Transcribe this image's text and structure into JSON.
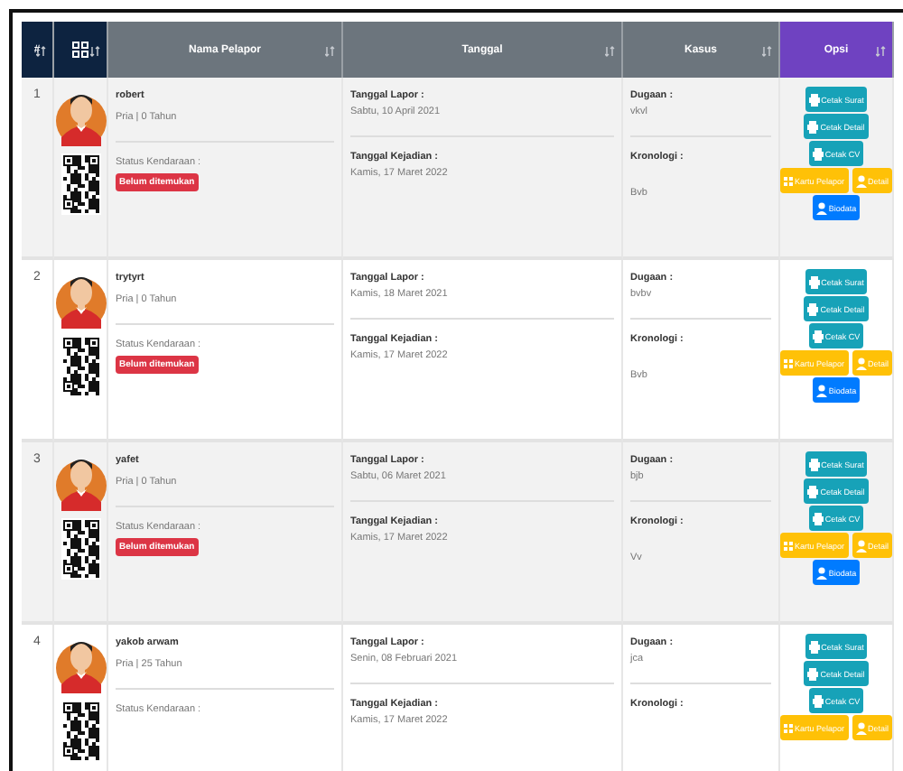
{
  "table": {
    "columns": [
      {
        "kind": "index",
        "label": "#"
      },
      {
        "kind": "qr"
      },
      {
        "kind": "plain",
        "label": "Nama Pelapor"
      },
      {
        "kind": "plain",
        "label": "Tanggal"
      },
      {
        "kind": "plain",
        "label": "Kasus"
      },
      {
        "kind": "action",
        "label": "Opsi"
      }
    ],
    "rows": [
      {
        "number": "1",
        "name": "robert",
        "gender_age": "Pria | 0 Tahun",
        "status_label": "Status Kendaraan :",
        "status": "Belum ditemukan",
        "report_label": "Tanggal Lapor :",
        "report_date": "Sabtu, 10 April 2021",
        "incident_label": "Tanggal Kejadian :",
        "incident_date": "Kamis, 17 Maret 2022",
        "suspect_label": "Dugaan :",
        "suspect": "vkvl",
        "chronology_label": "Kronologi :",
        "chronology": "Bvb",
        "actions": [
          {
            "kind": "print",
            "label": "Cetak Surat"
          },
          {
            "kind": "print",
            "label": "Cetak Detail"
          },
          {
            "kind": "print",
            "label": "Cetak CV"
          },
          {
            "kind": "card",
            "label": "Kartu Pelapor"
          },
          {
            "kind": "detail",
            "label": "Detail"
          },
          {
            "kind": "bio",
            "label": "Biodata"
          }
        ]
      },
      {
        "number": "2",
        "name": "trytyrt",
        "gender_age": "Pria | 0 Tahun",
        "status_label": "Status Kendaraan :",
        "status": "Belum ditemukan",
        "report_label": "Tanggal Lapor :",
        "report_date": "Kamis, 18 Maret 2021",
        "incident_label": "Tanggal Kejadian :",
        "incident_date": "Kamis, 17 Maret 2022",
        "suspect_label": "Dugaan :",
        "suspect": "bvbv",
        "chronology_label": "Kronologi :",
        "chronology": "Bvb",
        "actions": [
          {
            "kind": "print",
            "label": "Cetak Surat"
          },
          {
            "kind": "print",
            "label": "Cetak Detail"
          },
          {
            "kind": "print",
            "label": "Cetak CV"
          },
          {
            "kind": "card",
            "label": "Kartu Pelapor"
          },
          {
            "kind": "detail",
            "label": "Detail"
          },
          {
            "kind": "bio",
            "label": "Biodata"
          }
        ]
      },
      {
        "number": "3",
        "name": "yafet",
        "gender_age": "Pria | 0 Tahun",
        "status_label": "Status Kendaraan :",
        "status": "Belum ditemukan",
        "report_label": "Tanggal Lapor :",
        "report_date": "Sabtu, 06 Maret 2021",
        "incident_label": "Tanggal Kejadian :",
        "incident_date": "Kamis, 17 Maret 2022",
        "suspect_label": "Dugaan :",
        "suspect": "bjb",
        "chronology_label": "Kronologi :",
        "chronology": "Vv",
        "actions": [
          {
            "kind": "print",
            "label": "Cetak Surat"
          },
          {
            "kind": "print",
            "label": "Cetak Detail"
          },
          {
            "kind": "print",
            "label": "Cetak CV"
          },
          {
            "kind": "card",
            "label": "Kartu Pelapor"
          },
          {
            "kind": "detail",
            "label": "Detail"
          },
          {
            "kind": "bio",
            "label": "Biodata"
          }
        ]
      },
      {
        "number": "4",
        "name": "yakob arwam",
        "gender_age": "Pria | 25 Tahun",
        "status_label": "Status Kendaraan :",
        "report_label": "Tanggal Lapor :",
        "report_date": "Senin, 08 Februari 2021",
        "incident_label": "Tanggal Kejadian :",
        "incident_date": "Kamis, 17 Maret 2022",
        "suspect_label": "Dugaan :",
        "suspect": "jca",
        "chronology_label": "Kronologi :",
        "actions": [
          {
            "kind": "print",
            "label": "Cetak Surat"
          },
          {
            "kind": "print",
            "label": "Cetak Detail"
          },
          {
            "kind": "print",
            "label": "Cetak CV"
          },
          {
            "kind": "card",
            "label": "Kartu Pelapor"
          },
          {
            "kind": "detail",
            "label": "Detail"
          }
        ]
      }
    ]
  }
}
